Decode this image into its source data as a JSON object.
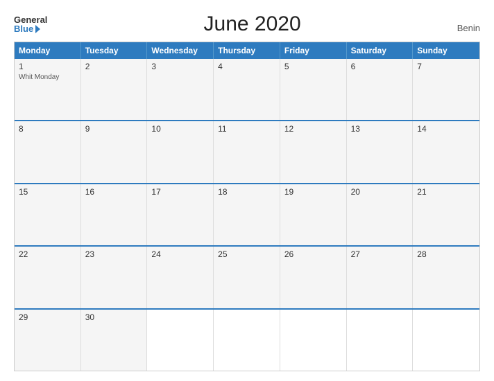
{
  "logo": {
    "general": "General",
    "blue": "Blue"
  },
  "title": "June 2020",
  "region": "Benin",
  "days_of_week": [
    "Monday",
    "Tuesday",
    "Wednesday",
    "Thursday",
    "Friday",
    "Saturday",
    "Sunday"
  ],
  "weeks": [
    [
      {
        "num": "1",
        "event": "Whit Monday"
      },
      {
        "num": "2",
        "event": ""
      },
      {
        "num": "3",
        "event": ""
      },
      {
        "num": "4",
        "event": ""
      },
      {
        "num": "5",
        "event": ""
      },
      {
        "num": "6",
        "event": ""
      },
      {
        "num": "7",
        "event": ""
      }
    ],
    [
      {
        "num": "8",
        "event": ""
      },
      {
        "num": "9",
        "event": ""
      },
      {
        "num": "10",
        "event": ""
      },
      {
        "num": "11",
        "event": ""
      },
      {
        "num": "12",
        "event": ""
      },
      {
        "num": "13",
        "event": ""
      },
      {
        "num": "14",
        "event": ""
      }
    ],
    [
      {
        "num": "15",
        "event": ""
      },
      {
        "num": "16",
        "event": ""
      },
      {
        "num": "17",
        "event": ""
      },
      {
        "num": "18",
        "event": ""
      },
      {
        "num": "19",
        "event": ""
      },
      {
        "num": "20",
        "event": ""
      },
      {
        "num": "21",
        "event": ""
      }
    ],
    [
      {
        "num": "22",
        "event": ""
      },
      {
        "num": "23",
        "event": ""
      },
      {
        "num": "24",
        "event": ""
      },
      {
        "num": "25",
        "event": ""
      },
      {
        "num": "26",
        "event": ""
      },
      {
        "num": "27",
        "event": ""
      },
      {
        "num": "28",
        "event": ""
      }
    ],
    [
      {
        "num": "29",
        "event": ""
      },
      {
        "num": "30",
        "event": ""
      },
      {
        "num": "",
        "event": ""
      },
      {
        "num": "",
        "event": ""
      },
      {
        "num": "",
        "event": ""
      },
      {
        "num": "",
        "event": ""
      },
      {
        "num": "",
        "event": ""
      }
    ]
  ]
}
